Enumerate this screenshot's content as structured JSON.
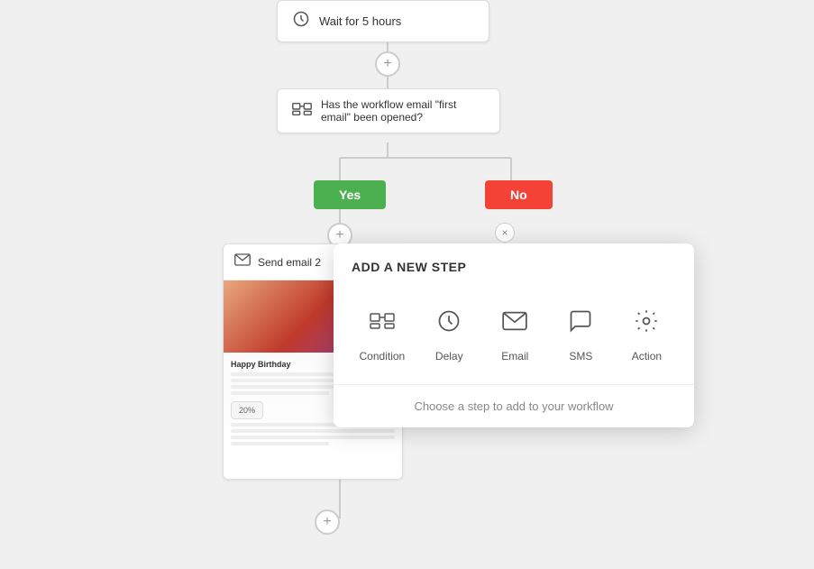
{
  "workflow": {
    "wait_node": {
      "label": "Wait for 5 hours",
      "icon": "clock"
    },
    "condition_node": {
      "label": "Has the workflow email \"first email\" been opened?",
      "icon": "condition"
    },
    "branches": {
      "yes_label": "Yes",
      "no_label": "No"
    },
    "email_node": {
      "label": "Send email 2"
    }
  },
  "modal": {
    "title": "ADD A NEW STEP",
    "steps": [
      {
        "id": "condition",
        "label": "Condition"
      },
      {
        "id": "delay",
        "label": "Delay"
      },
      {
        "id": "email",
        "label": "Email"
      },
      {
        "id": "sms",
        "label": "SMS"
      },
      {
        "id": "action",
        "label": "Action"
      }
    ],
    "footer_text": "Choose a step to add to your workflow"
  },
  "add_button_label": "+",
  "close_button_label": "×"
}
